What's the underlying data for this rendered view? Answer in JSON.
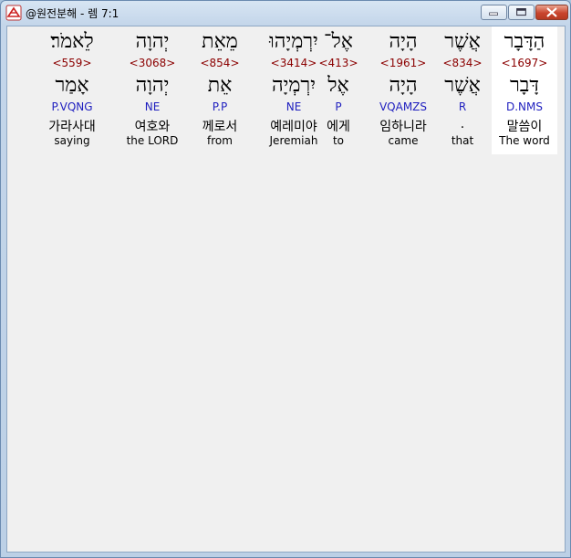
{
  "window": {
    "title": "@원전분해 - 렘 7:1",
    "controls": {
      "minimize": "minimize-icon",
      "maximize": "maximize-icon",
      "close": "close-icon"
    }
  },
  "words": [
    {
      "hebrew": "הַדָּבָר",
      "strong": "<1697>",
      "lemma": "דָּבָר",
      "morph": "D.NMS",
      "korean": "말씀이",
      "english": "The word",
      "selected": true
    },
    {
      "hebrew": "אֲשֶׁר",
      "strong": "<834>",
      "lemma": "אֲשֶׁר",
      "morph": "R",
      "korean": ".",
      "english": "that",
      "selected": false
    },
    {
      "hebrew": "הָיָה",
      "strong": "<1961>",
      "lemma": "הָיָה",
      "morph": "VQAMZS",
      "korean": "임하니라",
      "english": "came",
      "selected": false
    },
    {
      "hebrew": "אֶל־",
      "strong": "<413>",
      "lemma": "אֶל",
      "morph": "P",
      "korean": "에게",
      "english": "to",
      "selected": false
    },
    {
      "hebrew": "יִרְמְיָהוּ",
      "strong": "<3414>",
      "lemma": "יִרְמְיָה",
      "morph": "NE",
      "korean": "예레미야",
      "english": "Jeremiah",
      "selected": false
    },
    {
      "hebrew": "מֵאֵת",
      "strong": "<854>",
      "lemma": "אֵת",
      "morph": "P.P",
      "korean": "께로서",
      "english": "from",
      "selected": false
    },
    {
      "hebrew": "יְהוָה",
      "strong": "<3068>",
      "lemma": "יְהוָה",
      "morph": "NE",
      "korean": "여호와",
      "english": "the LORD",
      "selected": false
    },
    {
      "hebrew": "לֵאמֹר׃",
      "strong": "<559>",
      "lemma": "אָמַר",
      "morph": "P.VQNG",
      "korean": "가라사대",
      "english": "saying",
      "selected": false
    }
  ]
}
